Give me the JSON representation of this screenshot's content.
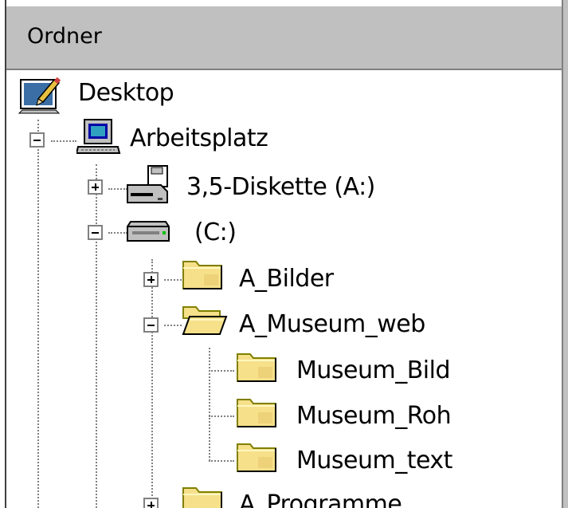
{
  "header": {
    "title": "Ordner"
  },
  "tree": {
    "desktop": {
      "label": "Desktop",
      "icon": "desktop-icon"
    },
    "arbeitsplatz": {
      "label": "Arbeitsplatz",
      "icon": "computer-icon",
      "expanded": true
    },
    "diskette": {
      "label": "3,5-Diskette (A:)",
      "icon": "floppy-drive-icon",
      "expanded": false
    },
    "drive_c": {
      "label": "(C:)",
      "icon": "hard-drive-icon",
      "expanded": true
    },
    "a_bilder": {
      "label": "A_Bilder",
      "icon": "folder-icon",
      "expanded": false
    },
    "a_museum_web": {
      "label": "A_Museum_web",
      "icon": "open-folder-icon",
      "expanded": true
    },
    "museum_bild": {
      "label": "Museum_Bild",
      "icon": "folder-icon"
    },
    "museum_roh": {
      "label": "Museum_Roh",
      "icon": "folder-icon"
    },
    "museum_text": {
      "label": "Museum_text",
      "icon": "folder-icon"
    },
    "a_programme": {
      "label": "A_Programme",
      "icon": "folder-icon",
      "expanded": false
    }
  },
  "colors": {
    "header_bg": "#c0c0c0",
    "folder_yellow": "#f6e08a",
    "tree_lines": "#808080"
  }
}
